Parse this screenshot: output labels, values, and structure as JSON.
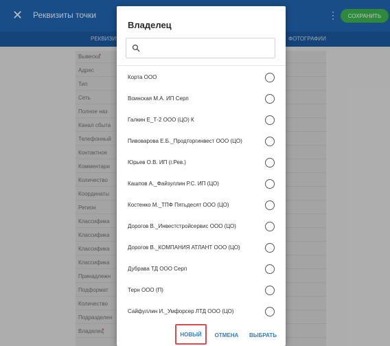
{
  "background": {
    "title": "Реквизиты точки",
    "save_label": "Сохранить",
    "tabs": [
      "Реквизиты",
      "Фотографии"
    ],
    "form_rows": [
      {
        "label": "Вывеска",
        "required": true
      },
      {
        "label": "Адрес",
        "required": false
      },
      {
        "label": "Тип",
        "required": false
      },
      {
        "label": "Сеть",
        "required": false
      },
      {
        "label": "Полное наз",
        "required": false
      },
      {
        "label": "Канал сбыта",
        "required": false
      },
      {
        "label": "Телефонный",
        "required": false
      },
      {
        "label": "Контактное",
        "required": false
      },
      {
        "label": "Комментари",
        "required": false
      },
      {
        "label": "Количество",
        "required": false
      },
      {
        "label": "Координаты",
        "required": false
      },
      {
        "label": "Регион",
        "required": false
      },
      {
        "label": "Классифика",
        "required": false
      },
      {
        "label": "Классифика",
        "required": false
      },
      {
        "label": "Классифика",
        "required": false
      },
      {
        "label": "Классифика",
        "required": false
      },
      {
        "label": "Принадлежн",
        "required": false
      },
      {
        "label": "Подформат",
        "required": false
      },
      {
        "label": "Количество",
        "required": false
      },
      {
        "label": "Подразделен",
        "required": false
      },
      {
        "label": "Владелец",
        "required": true
      }
    ]
  },
  "dialog": {
    "title": "Владелец",
    "search": {
      "value": "",
      "placeholder": ""
    },
    "owners": [
      "Корта ООО",
      "Воинская М.А. ИП Серп",
      "Галкин Е_Т-2 ООО (ЦО) К",
      "Пивоварова Е.Б._Продторгинвест ООО (ЦО)",
      "Юрьев О.В. ИП (г.Рев.)",
      "Кашпов А._Файзуллин Р.С. ИП (ЦО)",
      "Костенко М._ТПФ Пятьдесят ООО (ЦО)",
      "Дорогов В._Инвестстройсервис ООО (ЦО)",
      "Дорогов В._КОМПАНИЯ АТЛАНТ ООО (ЦО)",
      "Дубрава ТД ООО Серп",
      "Терн ООО (П)",
      "Сайфуллин И._Умфорсер ЛТД ООО (ЦО)"
    ],
    "buttons": {
      "new": "Новый",
      "cancel": "Отмена",
      "choose": "Выбрать"
    }
  }
}
